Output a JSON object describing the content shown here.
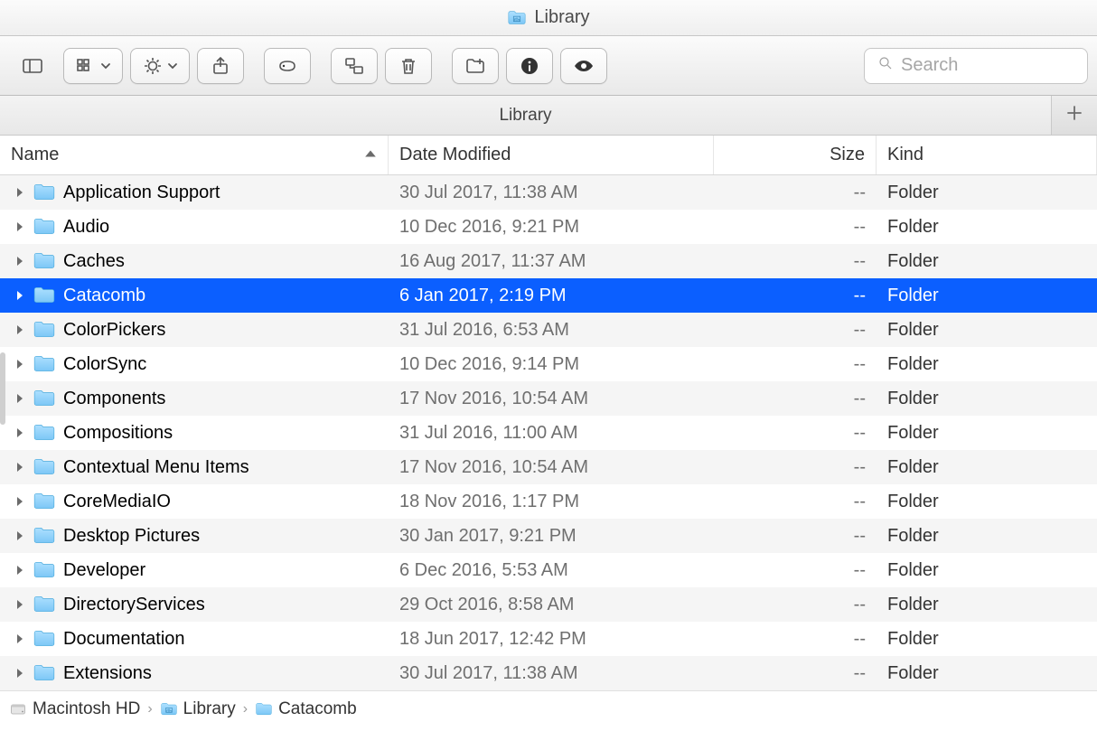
{
  "window": {
    "title": "Library"
  },
  "toolbar": {
    "search_placeholder": "Search"
  },
  "tabbar": {
    "active_tab": "Library"
  },
  "columns": {
    "name": "Name",
    "date": "Date Modified",
    "size": "Size",
    "kind": "Kind"
  },
  "breadcrumb": [
    {
      "icon": "drive",
      "label": "Macintosh HD"
    },
    {
      "icon": "system-folder",
      "label": "Library"
    },
    {
      "icon": "folder",
      "label": "Catacomb"
    }
  ],
  "items": [
    {
      "name": "Application Support",
      "date": "30 Jul 2017, 11:38 AM",
      "size": "--",
      "kind": "Folder",
      "selected": false
    },
    {
      "name": "Audio",
      "date": "10 Dec 2016, 9:21 PM",
      "size": "--",
      "kind": "Folder",
      "selected": false
    },
    {
      "name": "Caches",
      "date": "16 Aug 2017, 11:37 AM",
      "size": "--",
      "kind": "Folder",
      "selected": false
    },
    {
      "name": "Catacomb",
      "date": "6 Jan 2017, 2:19 PM",
      "size": "--",
      "kind": "Folder",
      "selected": true
    },
    {
      "name": "ColorPickers",
      "date": "31 Jul 2016, 6:53 AM",
      "size": "--",
      "kind": "Folder",
      "selected": false
    },
    {
      "name": "ColorSync",
      "date": "10 Dec 2016, 9:14 PM",
      "size": "--",
      "kind": "Folder",
      "selected": false
    },
    {
      "name": "Components",
      "date": "17 Nov 2016, 10:54 AM",
      "size": "--",
      "kind": "Folder",
      "selected": false
    },
    {
      "name": "Compositions",
      "date": "31 Jul 2016, 11:00 AM",
      "size": "--",
      "kind": "Folder",
      "selected": false
    },
    {
      "name": "Contextual Menu Items",
      "date": "17 Nov 2016, 10:54 AM",
      "size": "--",
      "kind": "Folder",
      "selected": false
    },
    {
      "name": "CoreMediaIO",
      "date": "18 Nov 2016, 1:17 PM",
      "size": "--",
      "kind": "Folder",
      "selected": false
    },
    {
      "name": "Desktop Pictures",
      "date": "30 Jan 2017, 9:21 PM",
      "size": "--",
      "kind": "Folder",
      "selected": false
    },
    {
      "name": "Developer",
      "date": "6 Dec 2016, 5:53 AM",
      "size": "--",
      "kind": "Folder",
      "selected": false
    },
    {
      "name": "DirectoryServices",
      "date": "29 Oct 2016, 8:58 AM",
      "size": "--",
      "kind": "Folder",
      "selected": false
    },
    {
      "name": "Documentation",
      "date": "18 Jun 2017, 12:42 PM",
      "size": "--",
      "kind": "Folder",
      "selected": false
    },
    {
      "name": "Extensions",
      "date": "30 Jul 2017, 11:38 AM",
      "size": "--",
      "kind": "Folder",
      "selected": false
    }
  ]
}
